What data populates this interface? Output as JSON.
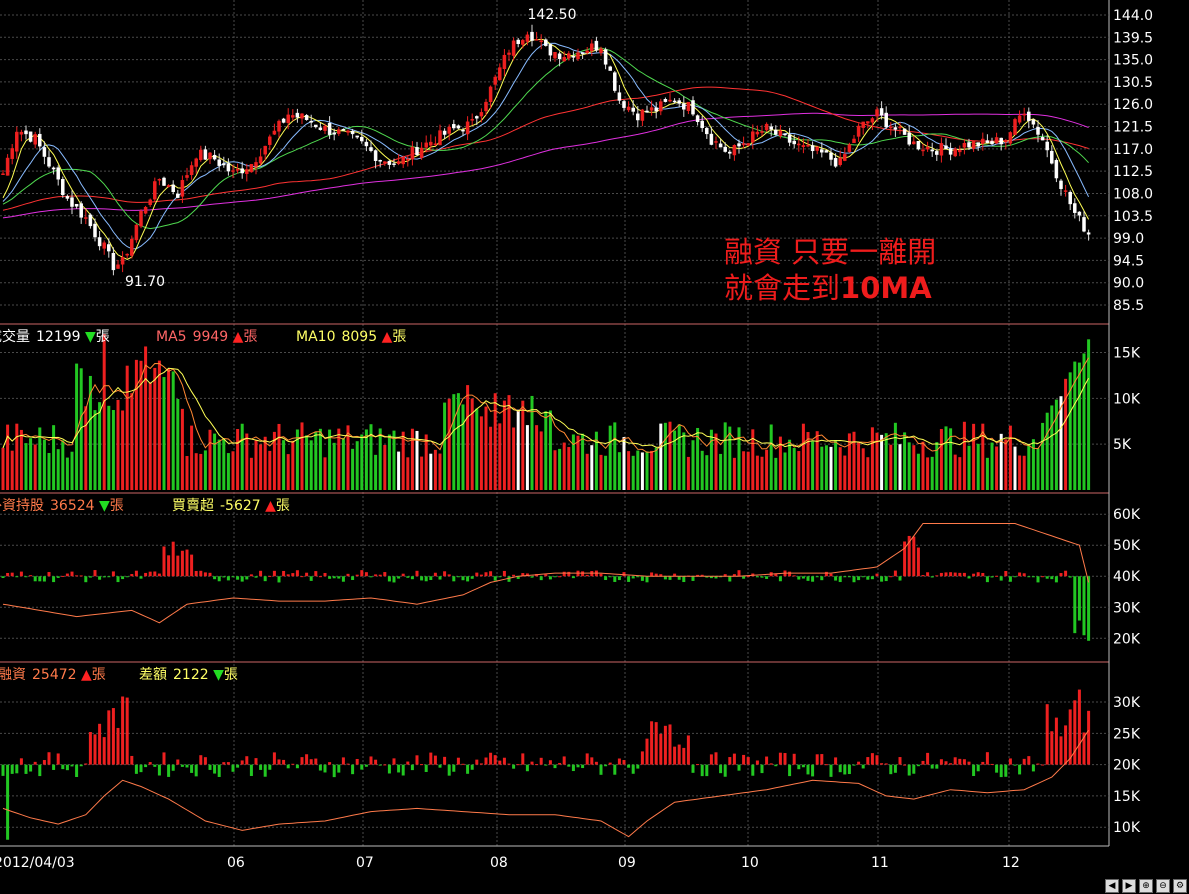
{
  "colors": {
    "up": "#ee2020",
    "down": "#22c722",
    "flat": "#ffffff",
    "ma5": "#ffff55",
    "ma10": "#88bbff",
    "ma20": "#4fd84f",
    "ma60": "#ff3333",
    "ma120": "#e030e0",
    "line": "#ff7a4a",
    "grid": "#4a4a4a",
    "frame": "#cc6666"
  },
  "price_panel": {
    "high_label": "142.50",
    "low_label": "91.70",
    "annotation_line1": "融資 只要一離開",
    "annotation_line2_a": "就會走到",
    "annotation_line2_b": "10MA",
    "ticks": [
      "144.0",
      "139.5",
      "135.0",
      "130.5",
      "126.0",
      "121.5",
      "117.0",
      "112.5",
      "108.0",
      "103.5",
      "99.0",
      "94.5",
      "90.0",
      "85.5"
    ]
  },
  "volume_panel": {
    "vol_label": "成交量",
    "vol_value": "12199",
    "vol_unit": "張",
    "ma5_label": "MA5",
    "ma5_value": "9949",
    "ma5_unit": "張",
    "ma10_label": "MA10",
    "ma10_value": "8095",
    "ma10_unit": "張",
    "ticks": [
      "15K",
      "10K",
      "5K"
    ]
  },
  "foreign_panel": {
    "label": "外資持股",
    "value": "36524",
    "unit": "張",
    "net_label": "買賣超",
    "net_value": "-5627",
    "net_unit": "張",
    "ticks": [
      "60K",
      "50K",
      "40K",
      "30K",
      "20K"
    ]
  },
  "margin_panel": {
    "label": "融資",
    "value": "25472",
    "unit": "張",
    "diff_label": "差額",
    "diff_value": "2122",
    "diff_unit": "張",
    "ticks": [
      "30K",
      "25K",
      "20K",
      "15K",
      "10K"
    ]
  },
  "x_axis": {
    "labels": [
      "2012/04/03",
      "06",
      "07",
      "08",
      "09",
      "10",
      "11",
      "12"
    ]
  },
  "chart_data": {
    "type": "candlestick",
    "x_labels": [
      "2012/04/03",
      "06",
      "07",
      "08",
      "09",
      "10",
      "11",
      "12"
    ],
    "price_axis": {
      "min": 85.5,
      "max": 144.0,
      "step": 4.5
    },
    "price_anchors": [
      [
        0,
        112
      ],
      [
        3,
        121
      ],
      [
        7,
        119
      ],
      [
        10,
        114
      ],
      [
        14,
        107
      ],
      [
        18,
        103
      ],
      [
        22,
        97
      ],
      [
        24,
        93.5
      ],
      [
        26,
        94
      ],
      [
        30,
        104
      ],
      [
        34,
        111
      ],
      [
        38,
        108
      ],
      [
        42,
        116
      ],
      [
        46,
        115
      ],
      [
        50,
        112
      ],
      [
        54,
        114
      ],
      [
        58,
        119
      ],
      [
        62,
        124
      ],
      [
        66,
        123
      ],
      [
        70,
        121
      ],
      [
        74,
        120
      ],
      [
        78,
        118
      ],
      [
        82,
        115
      ],
      [
        86,
        114
      ],
      [
        90,
        117
      ],
      [
        94,
        119
      ],
      [
        98,
        121
      ],
      [
        102,
        122
      ],
      [
        106,
        129
      ],
      [
        110,
        137
      ],
      [
        114,
        141
      ],
      [
        118,
        137
      ],
      [
        122,
        136
      ],
      [
        126,
        137
      ],
      [
        130,
        138
      ],
      [
        134,
        127
      ],
      [
        138,
        124
      ],
      [
        142,
        125
      ],
      [
        146,
        127
      ],
      [
        150,
        125
      ],
      [
        154,
        119
      ],
      [
        158,
        116
      ],
      [
        162,
        119
      ],
      [
        166,
        121
      ],
      [
        170,
        119
      ],
      [
        174,
        117
      ],
      [
        178,
        116
      ],
      [
        182,
        114
      ],
      [
        186,
        121
      ],
      [
        190,
        124
      ],
      [
        194,
        121
      ],
      [
        198,
        118
      ],
      [
        202,
        117
      ],
      [
        206,
        117
      ],
      [
        210,
        118
      ],
      [
        214,
        118
      ],
      [
        218,
        119
      ],
      [
        222,
        125
      ],
      [
        226,
        119
      ],
      [
        230,
        110
      ],
      [
        233,
        104
      ],
      [
        236,
        100
      ]
    ],
    "volume_axis_k": {
      "min": 0,
      "max": 18
    },
    "foreign_axis_k": {
      "min": 13,
      "max": 62
    },
    "foreign_holdings_anchors": [
      [
        0,
        31
      ],
      [
        8,
        29
      ],
      [
        16,
        27
      ],
      [
        22,
        28
      ],
      [
        28,
        29
      ],
      [
        34,
        25
      ],
      [
        40,
        31
      ],
      [
        50,
        33
      ],
      [
        60,
        32
      ],
      [
        70,
        32
      ],
      [
        80,
        33
      ],
      [
        90,
        31
      ],
      [
        100,
        34
      ],
      [
        106,
        38
      ],
      [
        112,
        40
      ],
      [
        120,
        41
      ],
      [
        130,
        41
      ],
      [
        140,
        40
      ],
      [
        150,
        40
      ],
      [
        160,
        40
      ],
      [
        170,
        41
      ],
      [
        180,
        41
      ],
      [
        190,
        43
      ],
      [
        196,
        49
      ],
      [
        200,
        57
      ],
      [
        210,
        57
      ],
      [
        220,
        57
      ],
      [
        226,
        54
      ],
      [
        230,
        52
      ],
      [
        234,
        50
      ],
      [
        236,
        38
      ]
    ],
    "margin_axis_k": {
      "min": 7,
      "max": 34
    },
    "margin_balance_anchors": [
      [
        0,
        13
      ],
      [
        6,
        11.5
      ],
      [
        12,
        10.5
      ],
      [
        18,
        12
      ],
      [
        22,
        15
      ],
      [
        26,
        17.5
      ],
      [
        30,
        16.5
      ],
      [
        36,
        14.5
      ],
      [
        44,
        11
      ],
      [
        52,
        9.5
      ],
      [
        60,
        10.5
      ],
      [
        70,
        11
      ],
      [
        80,
        12.5
      ],
      [
        90,
        13
      ],
      [
        100,
        12.5
      ],
      [
        110,
        12
      ],
      [
        120,
        12
      ],
      [
        130,
        11
      ],
      [
        136,
        8.5
      ],
      [
        140,
        11
      ],
      [
        146,
        14
      ],
      [
        156,
        15
      ],
      [
        166,
        16
      ],
      [
        176,
        17.5
      ],
      [
        186,
        17
      ],
      [
        192,
        15
      ],
      [
        198,
        14.5
      ],
      [
        206,
        16
      ],
      [
        214,
        15.5
      ],
      [
        222,
        16
      ],
      [
        228,
        18
      ],
      [
        232,
        21
      ],
      [
        236,
        25.5
      ]
    ]
  }
}
